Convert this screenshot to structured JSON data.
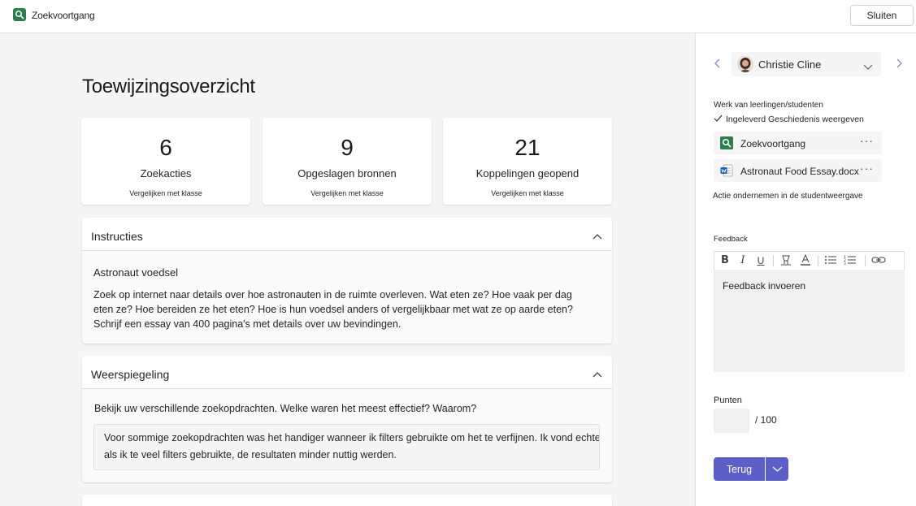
{
  "app": {
    "title": "Zoekvoortgang",
    "close_label": "Sluiten"
  },
  "main": {
    "title": "Toewijzingsoverzicht",
    "stats": [
      {
        "value": "6",
        "label": "Zoekacties",
        "compare": "Vergelijken met klasse"
      },
      {
        "value": "9",
        "label": "Opgeslagen bronnen",
        "compare": "Vergelijken met klasse"
      },
      {
        "value": "21",
        "label": "Koppelingen geopend",
        "compare": "Vergelijken met klasse"
      }
    ],
    "instructions": {
      "title": "Instructies",
      "heading": "Astronaut voedsel",
      "text_lines": [
        "Zoek op internet naar details over hoe astronauten in de ruimte overleven. Wat eten ze? Hoe vaak per dag",
        "eten ze? Hoe bereiden ze het eten? Hoe is hun voedsel anders of vergelijkbaar met wat ze op aarde eten?",
        "Schrijf een essay van 400 pagina's met details over uw bevindingen."
      ]
    },
    "reflection": {
      "title": "Weerspiegeling",
      "question": "Bekijk uw verschillende zoekopdrachten. Welke waren het meest effectief? Waarom?",
      "answer_lines": [
        "Voor sommige zoekopdrachten was het handiger wanneer ik filters gebruikte om het te verfijnen. Ik vond echter dat",
        "als ik te veel filters gebruikte, de resultaten minder nuttig werden."
      ]
    }
  },
  "sidebar": {
    "student_name": "Christie Cline",
    "work_label": "Werk van leerlingen/studenten",
    "status": "Ingeleverd",
    "history_link": "Geschiedenis weergeven",
    "files": [
      {
        "name": "Zoekvoortgang",
        "icon": "search-app-icon",
        "more": "···"
      },
      {
        "name": "Astronaut Food Essay.docx",
        "icon": "word-doc-icon",
        "more": "···"
      }
    ],
    "action_link": "Actie ondernemen in de studentweergave",
    "feedback_label": "Feedback",
    "feedback_placeholder": "Feedback invoeren",
    "points_label": "Punten",
    "points_value": "",
    "points_max": "/ 100",
    "return_label": "Terug",
    "colors": {
      "accent": "#5b5fc7",
      "app_green": "#2e7d4f",
      "word_blue": "#185abd"
    }
  }
}
